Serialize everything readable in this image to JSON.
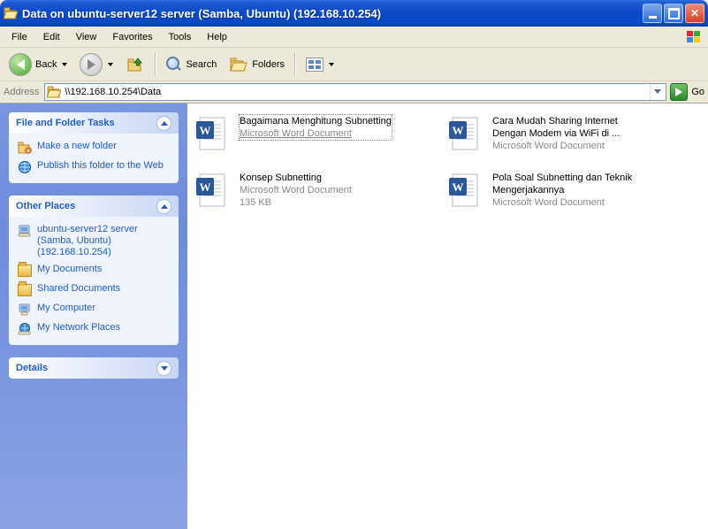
{
  "window": {
    "title": "Data on ubuntu-server12 server (Samba, Ubuntu) (192.168.10.254)"
  },
  "menu": {
    "file": "File",
    "edit": "Edit",
    "view": "View",
    "favorites": "Favorites",
    "tools": "Tools",
    "help": "Help"
  },
  "toolbar": {
    "back": "Back",
    "search": "Search",
    "folders": "Folders"
  },
  "addressbar": {
    "label": "Address",
    "path": "\\\\192.168.10.254\\Data",
    "go": "Go"
  },
  "sidebar": {
    "tasks": {
      "title": "File and Folder Tasks",
      "items": [
        {
          "label": "Make a new folder",
          "icon": "new-folder-icon"
        },
        {
          "label": "Publish this folder to the Web",
          "icon": "publish-web-icon"
        }
      ]
    },
    "places": {
      "title": "Other Places",
      "items": [
        {
          "label": "ubuntu-server12 server (Samba, Ubuntu) (192.168.10.254)",
          "icon": "computer-icon"
        },
        {
          "label": "My Documents",
          "icon": "folder-icon"
        },
        {
          "label": "Shared Documents",
          "icon": "folder-icon"
        },
        {
          "label": "My Computer",
          "icon": "my-computer-icon"
        },
        {
          "label": "My Network Places",
          "icon": "network-places-icon"
        }
      ]
    },
    "details": {
      "title": "Details"
    }
  },
  "files": [
    {
      "title": "Bagaimana Menghitung Subnetting",
      "type": "Microsoft Word Document",
      "size": "",
      "selected": true
    },
    {
      "title": "Cara Mudah Sharing Internet Dengan Modem via WiFi di ...",
      "type": "Microsoft Word Document",
      "size": "",
      "selected": false
    },
    {
      "title": "Konsep Subnetting",
      "type": "Microsoft Word Document",
      "size": "135 KB",
      "selected": false
    },
    {
      "title": "Pola Soal Subnetting dan Teknik Mengerjakannya",
      "type": "Microsoft Word Document",
      "size": "",
      "selected": false
    }
  ]
}
